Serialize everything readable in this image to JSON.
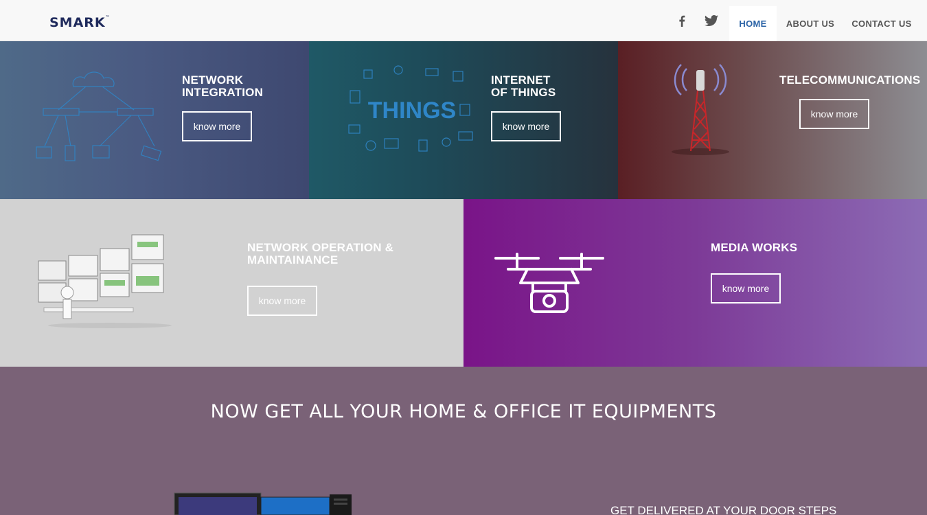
{
  "header": {
    "logo": "SMARK",
    "social": [
      "facebook-icon",
      "twitter-icon"
    ],
    "nav": [
      {
        "label": "HOME",
        "active": true
      },
      {
        "label": "ABOUT US",
        "active": false
      },
      {
        "label": "CONTACT US",
        "active": false
      }
    ]
  },
  "tiles": [
    {
      "title_line1": "NETWORK",
      "title_line2": "INTEGRATION",
      "button": "know more"
    },
    {
      "title_line1": "INTERNET",
      "title_line2": "OF THINGS",
      "button": "know more",
      "art_text": "THINGS"
    },
    {
      "title_line1": "TELECOMMUNICATIONS",
      "button": "know more"
    },
    {
      "title_line1": "NETWORK OPERATION &",
      "title_line2": "MAINTAINANCE",
      "button": "know more"
    },
    {
      "title_line1": "MEDIA WORKS",
      "button": "know more"
    }
  ],
  "promo": {
    "title": "NOW GET ALL YOUR HOME & OFFICE IT EQUIPMENTS",
    "subtitle": "GET DELIVERED AT YOUR DOOR STEPS"
  },
  "colors": {
    "nav_active": "#2b63a6",
    "logo": "#1f2a5c",
    "promo_bg": "#7a6277",
    "media_bg": "#7d3a97"
  }
}
